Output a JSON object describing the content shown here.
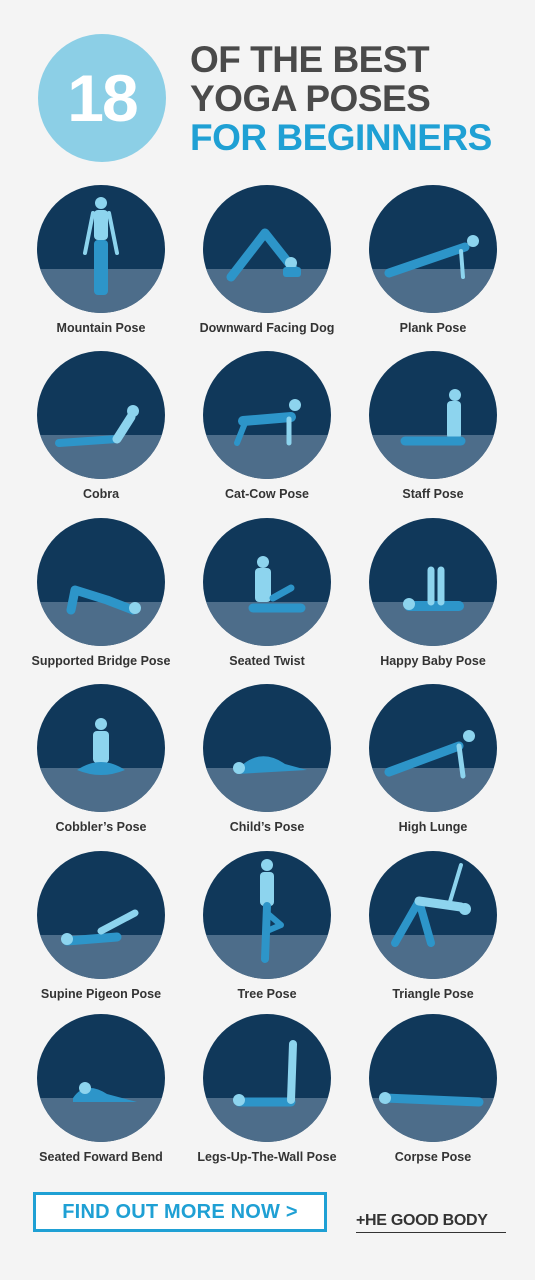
{
  "header": {
    "number": "18",
    "title_line1": "OF THE BEST",
    "title_line2": "YOGA POSES",
    "title_line3": "FOR BEGINNERS"
  },
  "poses": [
    {
      "label": "Mountain Pose",
      "icon": "mountain-pose-icon"
    },
    {
      "label": "Downward Facing Dog",
      "icon": "downward-dog-icon"
    },
    {
      "label": "Plank Pose",
      "icon": "plank-pose-icon"
    },
    {
      "label": "Cobra",
      "icon": "cobra-icon"
    },
    {
      "label": "Cat-Cow Pose",
      "icon": "cat-cow-icon"
    },
    {
      "label": "Staff Pose",
      "icon": "staff-pose-icon"
    },
    {
      "label": "Supported Bridge Pose",
      "icon": "bridge-pose-icon"
    },
    {
      "label": "Seated Twist",
      "icon": "seated-twist-icon"
    },
    {
      "label": "Happy Baby Pose",
      "icon": "happy-baby-icon"
    },
    {
      "label": "Cobbler’s Pose",
      "icon": "cobbler-pose-icon"
    },
    {
      "label": "Child’s Pose",
      "icon": "childs-pose-icon"
    },
    {
      "label": "High Lunge",
      "icon": "high-lunge-icon"
    },
    {
      "label": "Supine Pigeon Pose",
      "icon": "supine-pigeon-icon"
    },
    {
      "label": "Tree Pose",
      "icon": "tree-pose-icon"
    },
    {
      "label": "Triangle Pose",
      "icon": "triangle-pose-icon"
    },
    {
      "label": "Seated Foward Bend",
      "icon": "forward-bend-icon"
    },
    {
      "label": "Legs-Up-The-Wall Pose",
      "icon": "legs-up-wall-icon"
    },
    {
      "label": "Corpse Pose",
      "icon": "corpse-pose-icon"
    }
  ],
  "cta": {
    "label": "FIND OUT MORE NOW >"
  },
  "brand": {
    "name": "+HE GOOD BODY"
  },
  "colors": {
    "accent": "#1fa0d4",
    "badge": "#8ccfe6",
    "circle_top": "#10385a",
    "circle_floor": "#4d6d8a",
    "figure_light": "#8dd4ee",
    "figure_dark": "#2d95c9"
  }
}
